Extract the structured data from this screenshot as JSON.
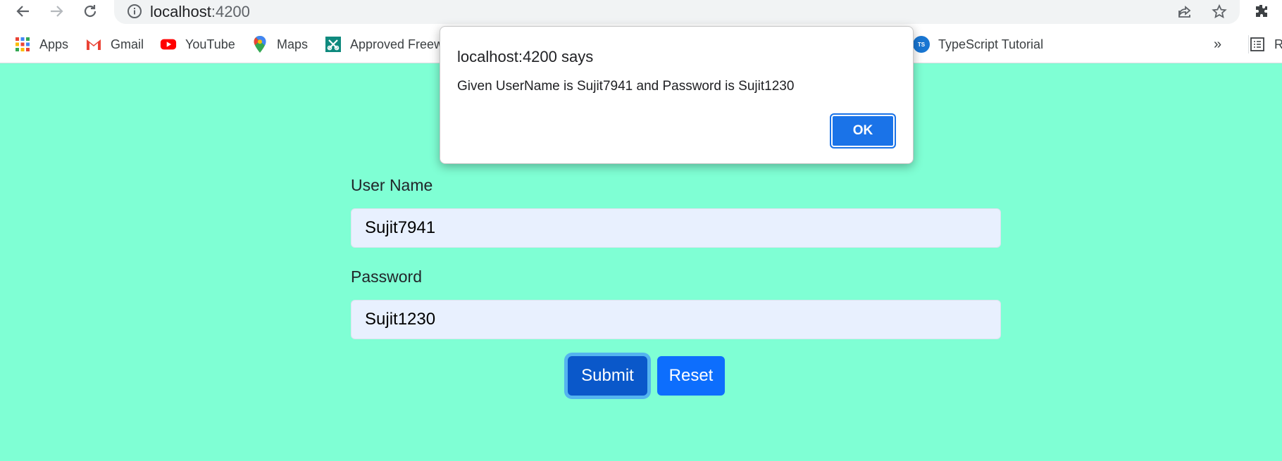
{
  "browser": {
    "url_host": "localhost",
    "url_port": ":4200",
    "bookmarks": [
      {
        "label": "Apps",
        "icon": "apps-grid-icon"
      },
      {
        "label": "Gmail",
        "icon": "gmail-icon"
      },
      {
        "label": "YouTube",
        "icon": "youtube-icon"
      },
      {
        "label": "Maps",
        "icon": "maps-pin-icon"
      },
      {
        "label": "Approved Freew",
        "icon": "approved-freeware-icon"
      },
      {
        "label": "TypeScript Tutorial",
        "icon": "typescript-icon"
      },
      {
        "label": "Re",
        "icon": "reading-list-icon"
      }
    ],
    "overflow_label": "»",
    "typescript_badge": "TS"
  },
  "form": {
    "username_label": "User Name",
    "username_value": "Sujit7941",
    "password_label": "Password",
    "password_value": "Sujit1230",
    "submit_label": "Submit",
    "reset_label": "Reset"
  },
  "dialog": {
    "title": "localhost:4200 says",
    "message": "Given UserName is Sujit7941 and Password is Sujit1230",
    "ok_label": "OK"
  },
  "colors": {
    "page_background": "#7fffd4",
    "input_background": "#e8f0fe",
    "submit_button": "#0a58ca",
    "reset_button": "#0d6efd",
    "dialog_ok_button": "#1a73e8"
  }
}
